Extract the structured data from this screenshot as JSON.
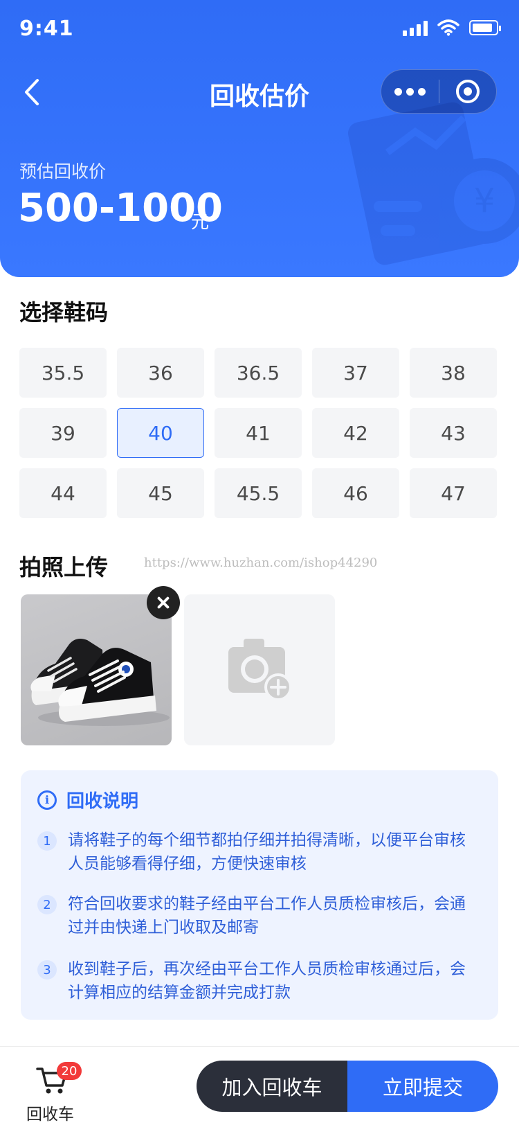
{
  "status_bar": {
    "time": "9:41"
  },
  "nav": {
    "title": "回收估价"
  },
  "estimate": {
    "label": "预估回收价",
    "price": "500-1000",
    "unit": "元"
  },
  "sizes": {
    "title": "选择鞋码",
    "options": [
      "35.5",
      "36",
      "36.5",
      "37",
      "38",
      "39",
      "40",
      "41",
      "42",
      "43",
      "44",
      "45",
      "45.5",
      "46",
      "47"
    ],
    "selected": "40"
  },
  "photos": {
    "title": "拍照上传",
    "watermark": "https://www.huzhan.com/ishop44290"
  },
  "notice": {
    "title": "回收说明",
    "items": [
      {
        "num": "1",
        "text": "请将鞋子的每个细节都拍仔细并拍得清晰，以便平台审核人员能够看得仔细，方便快速审核"
      },
      {
        "num": "2",
        "text": "符合回收要求的鞋子经由平台工作人员质检审核后，会通过并由快递上门收取及邮寄"
      },
      {
        "num": "3",
        "text": "收到鞋子后，再次经由平台工作人员质检审核通过后，会计算相应的结算金额并完成打款"
      }
    ]
  },
  "bottom": {
    "cart_label": "回收车",
    "cart_count": "20",
    "add_button": "加入回收车",
    "submit_button": "立即提交"
  },
  "colors": {
    "primary": "#2f6cf6",
    "dark_button": "#2b2f3a",
    "badge": "#f23a3a"
  }
}
